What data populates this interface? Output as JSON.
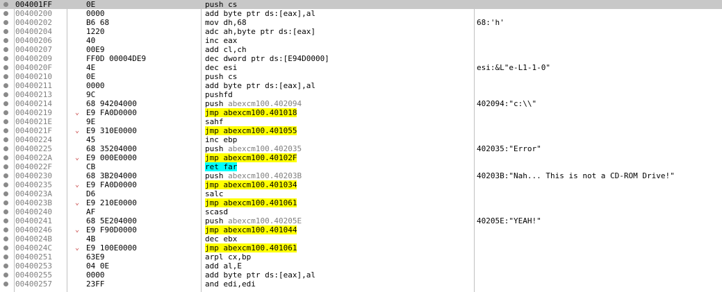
{
  "rows": [
    {
      "address": "004001FF",
      "bytes": "0E",
      "arrow": "",
      "mnemonic": "push cs",
      "operand": "",
      "comment": "",
      "highlight": "",
      "selected": true
    },
    {
      "address": "00400200",
      "bytes": "0000",
      "arrow": "",
      "mnemonic": "add byte ptr ds:[eax],al",
      "operand": "",
      "comment": "",
      "highlight": "",
      "selected": false
    },
    {
      "address": "00400202",
      "bytes": "B6 68",
      "arrow": "",
      "mnemonic": "mov dh,68",
      "operand": "",
      "comment": "68:'h'",
      "highlight": "",
      "selected": false
    },
    {
      "address": "00400204",
      "bytes": "1220",
      "arrow": "",
      "mnemonic": "adc ah,byte ptr ds:[eax]",
      "operand": "",
      "comment": "",
      "highlight": "",
      "selected": false
    },
    {
      "address": "00400206",
      "bytes": "40",
      "arrow": "",
      "mnemonic": "inc eax",
      "operand": "",
      "comment": "",
      "highlight": "",
      "selected": false
    },
    {
      "address": "00400207",
      "bytes": "00E9",
      "arrow": "",
      "mnemonic": "add cl,ch",
      "operand": "",
      "comment": "",
      "highlight": "",
      "selected": false
    },
    {
      "address": "00400209",
      "bytes": "FF0D 00004DE9",
      "arrow": "",
      "mnemonic": "dec dword ptr ds:[E94D0000]",
      "operand": "",
      "comment": "",
      "highlight": "",
      "selected": false
    },
    {
      "address": "0040020F",
      "bytes": "4E",
      "arrow": "",
      "mnemonic": "dec esi",
      "operand": "",
      "comment": "esi:&L\"e-L1-1-0\"",
      "highlight": "",
      "selected": false
    },
    {
      "address": "00400210",
      "bytes": "0E",
      "arrow": "",
      "mnemonic": "push cs",
      "operand": "",
      "comment": "",
      "highlight": "",
      "selected": false
    },
    {
      "address": "00400211",
      "bytes": "0000",
      "arrow": "",
      "mnemonic": "add byte ptr ds:[eax],al",
      "operand": "",
      "comment": "",
      "highlight": "",
      "selected": false
    },
    {
      "address": "00400213",
      "bytes": "9C",
      "arrow": "",
      "mnemonic": "pushfd",
      "operand": "",
      "comment": "",
      "highlight": "",
      "selected": false
    },
    {
      "address": "00400214",
      "bytes": "68 94204000",
      "arrow": "",
      "mnemonic": "push ",
      "operand": "abexcm100.402094",
      "comment": "402094:\"c:\\\\\"",
      "highlight": "",
      "selected": false
    },
    {
      "address": "00400219",
      "bytes": "E9 FA0D0000",
      "arrow": "⌄",
      "mnemonic": "jmp abexcm100.401018",
      "operand": "",
      "comment": "",
      "highlight": "jmp",
      "selected": false
    },
    {
      "address": "0040021E",
      "bytes": "9E",
      "arrow": "",
      "mnemonic": "sahf",
      "operand": "",
      "comment": "",
      "highlight": "",
      "selected": false
    },
    {
      "address": "0040021F",
      "bytes": "E9 310E0000",
      "arrow": "⌄",
      "mnemonic": "jmp abexcm100.401055",
      "operand": "",
      "comment": "",
      "highlight": "jmp",
      "selected": false
    },
    {
      "address": "00400224",
      "bytes": "45",
      "arrow": "",
      "mnemonic": "inc ebp",
      "operand": "",
      "comment": "",
      "highlight": "",
      "selected": false
    },
    {
      "address": "00400225",
      "bytes": "68 35204000",
      "arrow": "",
      "mnemonic": "push ",
      "operand": "abexcm100.402035",
      "comment": "402035:\"Error\"",
      "highlight": "",
      "selected": false
    },
    {
      "address": "0040022A",
      "bytes": "E9 000E0000",
      "arrow": "⌄",
      "mnemonic": "jmp abexcm100.40102F",
      "operand": "",
      "comment": "",
      "highlight": "jmp",
      "selected": false
    },
    {
      "address": "0040022F",
      "bytes": "CB",
      "arrow": "",
      "mnemonic": "ret far",
      "operand": "",
      "comment": "",
      "highlight": "ret",
      "selected": false
    },
    {
      "address": "00400230",
      "bytes": "68 3B204000",
      "arrow": "",
      "mnemonic": "push ",
      "operand": "abexcm100.40203B",
      "comment": "40203B:\"Nah... This is not a CD-ROM Drive!\"",
      "highlight": "",
      "selected": false
    },
    {
      "address": "00400235",
      "bytes": "E9 FA0D0000",
      "arrow": "⌄",
      "mnemonic": "jmp abexcm100.401034",
      "operand": "",
      "comment": "",
      "highlight": "jmp",
      "selected": false
    },
    {
      "address": "0040023A",
      "bytes": "D6",
      "arrow": "",
      "mnemonic": "salc",
      "operand": "",
      "comment": "",
      "highlight": "",
      "selected": false
    },
    {
      "address": "0040023B",
      "bytes": "E9 210E0000",
      "arrow": "⌄",
      "mnemonic": "jmp abexcm100.401061",
      "operand": "",
      "comment": "",
      "highlight": "jmp",
      "selected": false
    },
    {
      "address": "00400240",
      "bytes": "AF",
      "arrow": "",
      "mnemonic": "scasd",
      "operand": "",
      "comment": "",
      "highlight": "",
      "selected": false
    },
    {
      "address": "00400241",
      "bytes": "68 5E204000",
      "arrow": "",
      "mnemonic": "push ",
      "operand": "abexcm100.40205E",
      "comment": "40205E:\"YEAH!\"",
      "highlight": "",
      "selected": false
    },
    {
      "address": "00400246",
      "bytes": "E9 F90D0000",
      "arrow": "⌄",
      "mnemonic": "jmp abexcm100.401044",
      "operand": "",
      "comment": "",
      "highlight": "jmp",
      "selected": false
    },
    {
      "address": "0040024B",
      "bytes": "4B",
      "arrow": "",
      "mnemonic": "dec ebx",
      "operand": "",
      "comment": "",
      "highlight": "",
      "selected": false
    },
    {
      "address": "0040024C",
      "bytes": "E9 100E0000",
      "arrow": "⌄",
      "mnemonic": "jmp abexcm100.401061",
      "operand": "",
      "comment": "",
      "highlight": "jmp",
      "selected": false
    },
    {
      "address": "00400251",
      "bytes": "63E9",
      "arrow": "",
      "mnemonic": "arpl cx,bp",
      "operand": "",
      "comment": "",
      "highlight": "",
      "selected": false
    },
    {
      "address": "00400253",
      "bytes": "04 0E",
      "arrow": "",
      "mnemonic": "add al,E",
      "operand": "",
      "comment": "",
      "highlight": "",
      "selected": false
    },
    {
      "address": "00400255",
      "bytes": "0000",
      "arrow": "",
      "mnemonic": "add byte ptr ds:[eax],al",
      "operand": "",
      "comment": "",
      "highlight": "",
      "selected": false
    },
    {
      "address": "00400257",
      "bytes": "23FF",
      "arrow": "",
      "mnemonic": "and edi,edi",
      "operand": "",
      "comment": "",
      "highlight": "",
      "selected": false
    }
  ],
  "colors": {
    "jmp_highlight": "#ffff00",
    "ret_highlight": "#00ffff",
    "selected_row": "#c8c8c8",
    "address_text": "#808080",
    "arrow": "#c84040"
  }
}
